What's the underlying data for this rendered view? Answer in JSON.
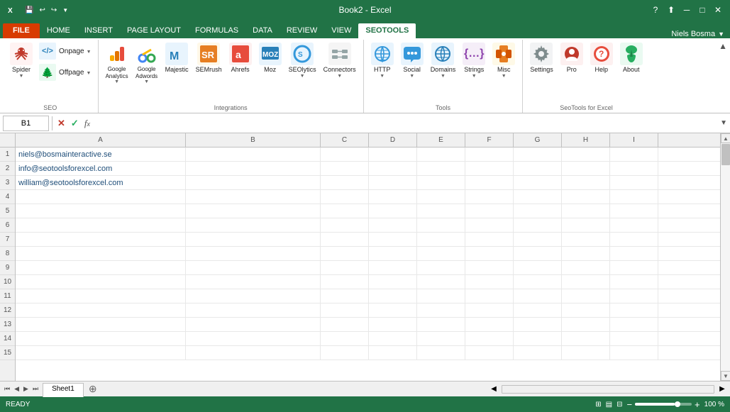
{
  "titleBar": {
    "appIcon": "X",
    "title": "Book2 - Excel",
    "quickAccess": [
      "💾",
      "↩",
      "↪"
    ],
    "windowControls": [
      "?",
      "□─",
      "□",
      "✕"
    ]
  },
  "ribbonTabs": {
    "tabs": [
      "FILE",
      "HOME",
      "INSERT",
      "PAGE LAYOUT",
      "FORMULAS",
      "DATA",
      "REVIEW",
      "VIEW",
      "SEOTOOLS"
    ],
    "activeTab": "SEOTOOLS",
    "user": "Niels Bosma"
  },
  "ribbon": {
    "groups": [
      {
        "name": "SEO",
        "items": [
          {
            "id": "spider",
            "label": "Spider",
            "icon": "🕷",
            "size": "large"
          },
          {
            "id": "onpage",
            "label": "Onpage",
            "icon": "</>",
            "size": "large"
          },
          {
            "id": "offpage",
            "label": "Offpage",
            "icon": "🌲",
            "size": "large"
          }
        ]
      },
      {
        "name": "Integrations",
        "items": [
          {
            "id": "google-analytics",
            "label": "Google\nAnalytics",
            "icon": "📊",
            "size": "large"
          },
          {
            "id": "google-adwords",
            "label": "Google\nAdwords",
            "icon": "🔑",
            "size": "large"
          },
          {
            "id": "majestic",
            "label": "Majestic",
            "icon": "M",
            "size": "large"
          },
          {
            "id": "semrush",
            "label": "SEMrush",
            "icon": "S",
            "size": "large"
          },
          {
            "id": "ahrefs",
            "label": "Ahrefs",
            "icon": "a",
            "size": "large"
          },
          {
            "id": "moz",
            "label": "Moz",
            "icon": "moz",
            "size": "large"
          },
          {
            "id": "seolytics",
            "label": "SEOlytics",
            "icon": "S",
            "size": "large"
          },
          {
            "id": "connectors",
            "label": "Connectors",
            "icon": "⚙",
            "size": "large"
          }
        ]
      },
      {
        "name": "Tools",
        "items": [
          {
            "id": "http",
            "label": "HTTP",
            "icon": "⬇",
            "size": "large"
          },
          {
            "id": "social",
            "label": "Social",
            "icon": "🐦",
            "size": "large"
          },
          {
            "id": "domains",
            "label": "Domains",
            "icon": "🌐",
            "size": "large"
          },
          {
            "id": "strings",
            "label": "Strings",
            "icon": "{}",
            "size": "large"
          },
          {
            "id": "misc",
            "label": "Misc",
            "icon": "🔧",
            "size": "large"
          }
        ]
      },
      {
        "name": "SeoTools for Excel",
        "items": [
          {
            "id": "settings",
            "label": "Settings",
            "icon": "⚙",
            "size": "large"
          },
          {
            "id": "pro",
            "label": "Pro",
            "icon": "👁",
            "size": "large"
          },
          {
            "id": "help",
            "label": "Help",
            "icon": "🆘",
            "size": "large"
          },
          {
            "id": "about",
            "label": "About",
            "icon": "🌿",
            "size": "large"
          }
        ]
      }
    ]
  },
  "formulaBar": {
    "cellRef": "B1",
    "formula": ""
  },
  "columns": [
    "A",
    "B",
    "C",
    "D",
    "E",
    "F",
    "G",
    "H",
    "I"
  ],
  "rows": [
    {
      "num": 1,
      "cells": [
        "niels@bosmainteractive.se",
        "",
        "",
        "",
        "",
        "",
        "",
        "",
        ""
      ]
    },
    {
      "num": 2,
      "cells": [
        "info@seotoolsforexcel.com",
        "",
        "",
        "",
        "",
        "",
        "",
        "",
        ""
      ]
    },
    {
      "num": 3,
      "cells": [
        "william@seotoolsforexcel.com",
        "",
        "",
        "",
        "",
        "",
        "",
        "",
        ""
      ]
    },
    {
      "num": 4,
      "cells": [
        "",
        "",
        "",
        "",
        "",
        "",
        "",
        "",
        ""
      ]
    },
    {
      "num": 5,
      "cells": [
        "",
        "",
        "",
        "",
        "",
        "",
        "",
        "",
        ""
      ]
    },
    {
      "num": 6,
      "cells": [
        "",
        "",
        "",
        "",
        "",
        "",
        "",
        "",
        ""
      ]
    },
    {
      "num": 7,
      "cells": [
        "",
        "",
        "",
        "",
        "",
        "",
        "",
        "",
        ""
      ]
    },
    {
      "num": 8,
      "cells": [
        "",
        "",
        "",
        "",
        "",
        "",
        "",
        "",
        ""
      ]
    },
    {
      "num": 9,
      "cells": [
        "",
        "",
        "",
        "",
        "",
        "",
        "",
        "",
        ""
      ]
    },
    {
      "num": 10,
      "cells": [
        "",
        "",
        "",
        "",
        "",
        "",
        "",
        "",
        ""
      ]
    },
    {
      "num": 11,
      "cells": [
        "",
        "",
        "",
        "",
        "",
        "",
        "",
        "",
        ""
      ]
    },
    {
      "num": 12,
      "cells": [
        "",
        "",
        "",
        "",
        "",
        "",
        "",
        "",
        ""
      ]
    },
    {
      "num": 13,
      "cells": [
        "",
        "",
        "",
        "",
        "",
        "",
        "",
        "",
        ""
      ]
    },
    {
      "num": 14,
      "cells": [
        "",
        "",
        "",
        "",
        "",
        "",
        "",
        "",
        ""
      ]
    },
    {
      "num": 15,
      "cells": [
        "",
        "",
        "",
        "",
        "",
        "",
        "",
        "",
        ""
      ]
    }
  ],
  "statusBar": {
    "status": "READY",
    "zoom": "100 %"
  },
  "tabs": {
    "sheets": [
      "Sheet1"
    ],
    "activeSheet": "Sheet1"
  }
}
